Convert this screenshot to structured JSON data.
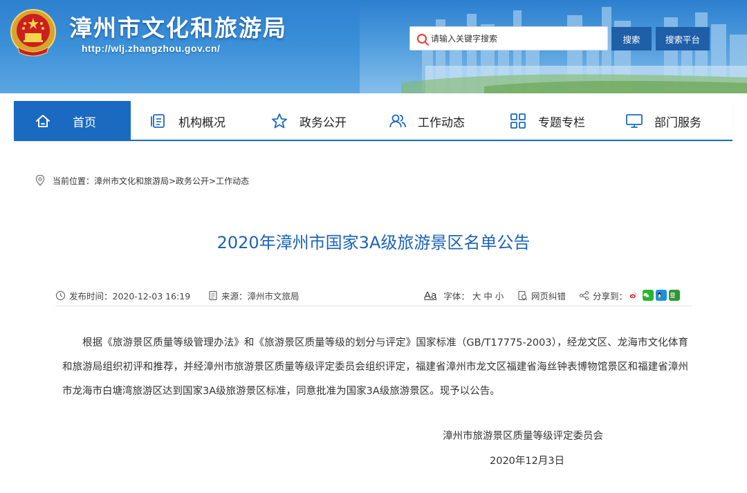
{
  "header": {
    "site_title": "漳州市文化和旅游局",
    "site_url": "http://wlj.zhangzhou.gov.cn/",
    "search": {
      "placeholder": "请输入关键字搜索",
      "search_label": "搜索",
      "site_search_label": "搜索平台"
    }
  },
  "nav": {
    "items": [
      {
        "label": "首页",
        "icon": "home-icon",
        "active": true
      },
      {
        "label": "机构概况",
        "icon": "document-icon"
      },
      {
        "label": "政务公开",
        "icon": "star-icon"
      },
      {
        "label": "工作动态",
        "icon": "users-icon"
      },
      {
        "label": "专题专栏",
        "icon": "grid-icon"
      },
      {
        "label": "部门服务",
        "icon": "monitor-icon"
      }
    ]
  },
  "breadcrumb": {
    "text": "当前位置：漳州市文化和旅游局>政务公开>工作动态"
  },
  "article": {
    "title": "2020年漳州市国家3A级旅游景区名单公告",
    "meta": {
      "date": "发布时间：2020-12-03 16:19",
      "source": "来源：漳州市文旅局",
      "font_glyph": "Aa",
      "font_label": "字体：",
      "font_large": "大",
      "font_medium": "中",
      "font_small": "小",
      "correct_label": "网页纠错",
      "share_label": "分享到："
    },
    "body": "根据《旅游景区质量等级管理办法》和《旅游景区质量等级的划分与评定》国家标准（GB/T17775-2003），经龙文区、龙海市文化体育和旅游局组织初评和推荐，并经漳州市旅游景区质量等级评定委员会组织评定，福建省漳州市龙文区福建省海丝钟表博物馆景区和福建省漳州市龙海市白塘湾旅游区达到国家3A级旅游景区标准，同意批准为国家3A级旅游景区。现予以公告。",
    "signature": "漳州市旅游景区质量等级评定委员会",
    "sign_date": "2020年12月3日"
  },
  "colors": {
    "primary_blue": "#1a6ac2",
    "title_blue": "#1a63b8",
    "search_button": "#1f5fa8",
    "weibo": "#e6162d",
    "wechat": "#2ab431",
    "qq": "#1d8fe1",
    "douban": "#2f9833"
  }
}
